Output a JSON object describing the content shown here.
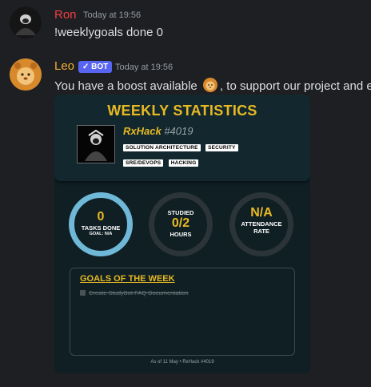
{
  "messages": [
    {
      "author": "Ron",
      "author_color": "#f23f43",
      "timestamp": "Today at 19:56",
      "content": "!weeklygoals done 0"
    },
    {
      "author": "Leo",
      "author_color": "#f0b232",
      "bot_badge": "✓ BOT",
      "timestamp": "Today at 19:56",
      "content_before": "You have a boost available",
      "content_after": ", to support our project and e",
      "inline_icon": "lion-emoji-icon"
    }
  ],
  "card": {
    "title": "WEEKLY STATISTICS",
    "username": "RxHack",
    "discriminator": "#4019",
    "tags": [
      "SOLUTION ARCHITECTURE",
      "SECURITY",
      "SRE/DEVOPS",
      "HACKING"
    ],
    "stats": {
      "tasks": {
        "value": "0",
        "label": "TASKS DONE",
        "sub": "GOAL: N/A"
      },
      "studied": {
        "top": "STUDIED",
        "value": "0/2",
        "bottom": "HOURS"
      },
      "attendance": {
        "value": "N/A",
        "line1": "ATTENDANCE",
        "line2": "RATE"
      }
    },
    "goals_title": "GOALS OF THE WEEK",
    "goals": [
      "Create StudyBot FAQ Documentation"
    ],
    "footer": "As of 11 May • RxHack #4019"
  },
  "colors": {
    "background": "#1e1f22",
    "card": "#0f1f24",
    "accent_gold": "#e8b923",
    "ring_active": "#6fb8d8",
    "bot_badge": "#5865f2"
  }
}
